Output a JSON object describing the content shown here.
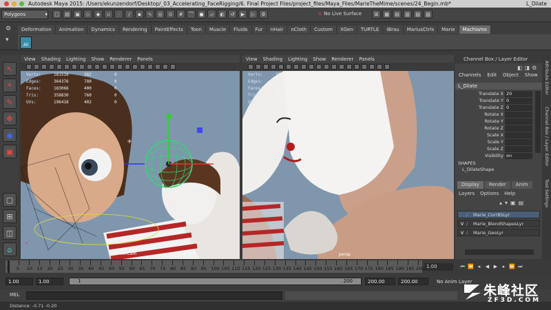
{
  "window": {
    "title": "Autodesk Maya 2015: /Users/ekunzendorf/Desktop/_03_Accelerating_FaceRigging/6. Final Project Files/project_files/Maya_Files/MarieTheMime/scenes/24_Begin.mb*",
    "selected_object": "L_Dilate",
    "traffic_colors": [
      "#e0443e",
      "#e0b03b",
      "#5cb744"
    ]
  },
  "status_line": {
    "mode": "Polygons",
    "live_surface": "No Live Surface"
  },
  "shelf": {
    "tabs": [
      "Deformation",
      "Animation",
      "Dynamics",
      "Rendering",
      "PaintEffects",
      "Toon",
      "Muscle",
      "Fluids",
      "Fur",
      "nHair",
      "nCloth",
      "Custom",
      "XGen",
      "TURTLE",
      "IBrau",
      "MariusCtrls",
      "Marie",
      "Machismo"
    ],
    "active_tab": "Machismo",
    "all_label": "All"
  },
  "viewport_menu": [
    "View",
    "Shading",
    "Lighting",
    "Show",
    "Renderer",
    "Panels"
  ],
  "hud": {
    "rows": [
      {
        "label": "Verts:",
        "c1": "181516",
        "c2": "382",
        "c3": "0"
      },
      {
        "label": "Edges:",
        "c1": "364376",
        "c2": "780",
        "c3": "0"
      },
      {
        "label": "Faces:",
        "c1": "183066",
        "c2": "400",
        "c3": "0"
      },
      {
        "label": "Tris:",
        "c1": "358830",
        "c2": "760",
        "c3": "0"
      },
      {
        "label": "UVs:",
        "c1": "196418",
        "c2": "402",
        "c3": "0"
      }
    ]
  },
  "left_viewport": {
    "camera_label": "mnCam"
  },
  "right_viewport": {
    "camera_label": "persp"
  },
  "channel_box": {
    "header": "Channel Box / Layer Editor",
    "menu": [
      "Channels",
      "Edit",
      "Object",
      "Show"
    ],
    "object_name": "L_Dilate",
    "attributes": [
      {
        "name": "Translate X",
        "value": "20"
      },
      {
        "name": "Translate Y",
        "value": "0"
      },
      {
        "name": "Translate Z",
        "value": "0"
      },
      {
        "name": "Rotate X",
        "value": ""
      },
      {
        "name": "Rotate Y",
        "value": ""
      },
      {
        "name": "Rotate Z",
        "value": ""
      },
      {
        "name": "Scale X",
        "value": ""
      },
      {
        "name": "Scale Y",
        "value": ""
      },
      {
        "name": "Scale Z",
        "value": ""
      },
      {
        "name": "Visibility",
        "value": "on"
      }
    ],
    "shapes_label": "SHAPES",
    "shape_name": "L_DilateShape",
    "layer_tabs": [
      "Display",
      "Render",
      "Anim"
    ],
    "layer_menu": [
      "Layers",
      "Options",
      "Help"
    ],
    "layers": [
      {
        "vis": "",
        "name": "Marie_CorrBSLyr"
      },
      {
        "vis": "V",
        "name": "Marie_BlendShapesLyr"
      },
      {
        "vis": "V",
        "name": "Marie_GeoLyr"
      }
    ]
  },
  "side_tabs": [
    "Attribute Editor",
    "Channel Box / Layer Editor",
    "Tool Settings"
  ],
  "timeline": {
    "ticks": [
      "1",
      "5",
      "10",
      "15",
      "20",
      "25",
      "30",
      "35",
      "40",
      "45",
      "50",
      "55",
      "60",
      "65",
      "70",
      "75",
      "80",
      "85",
      "90",
      "95",
      "100",
      "105",
      "110",
      "115",
      "120",
      "125",
      "130",
      "135",
      "140",
      "145",
      "150",
      "155",
      "160",
      "165",
      "170",
      "175",
      "180",
      "185",
      "190",
      "195",
      "200"
    ],
    "current_frame": "1.00"
  },
  "range": {
    "start": "1.00",
    "playback_start": "1.00",
    "slider_start": "1",
    "slider_end": "200",
    "playback_end": "200.00",
    "end": "200.00",
    "anim_layer": "No Anim Layer"
  },
  "command_line": {
    "label": "MEL"
  },
  "help_line": {
    "text": "Distance:   -0.71     -0.20"
  },
  "watermark": {
    "text": "朱峰社区",
    "sub": "ZF3D.COM"
  }
}
